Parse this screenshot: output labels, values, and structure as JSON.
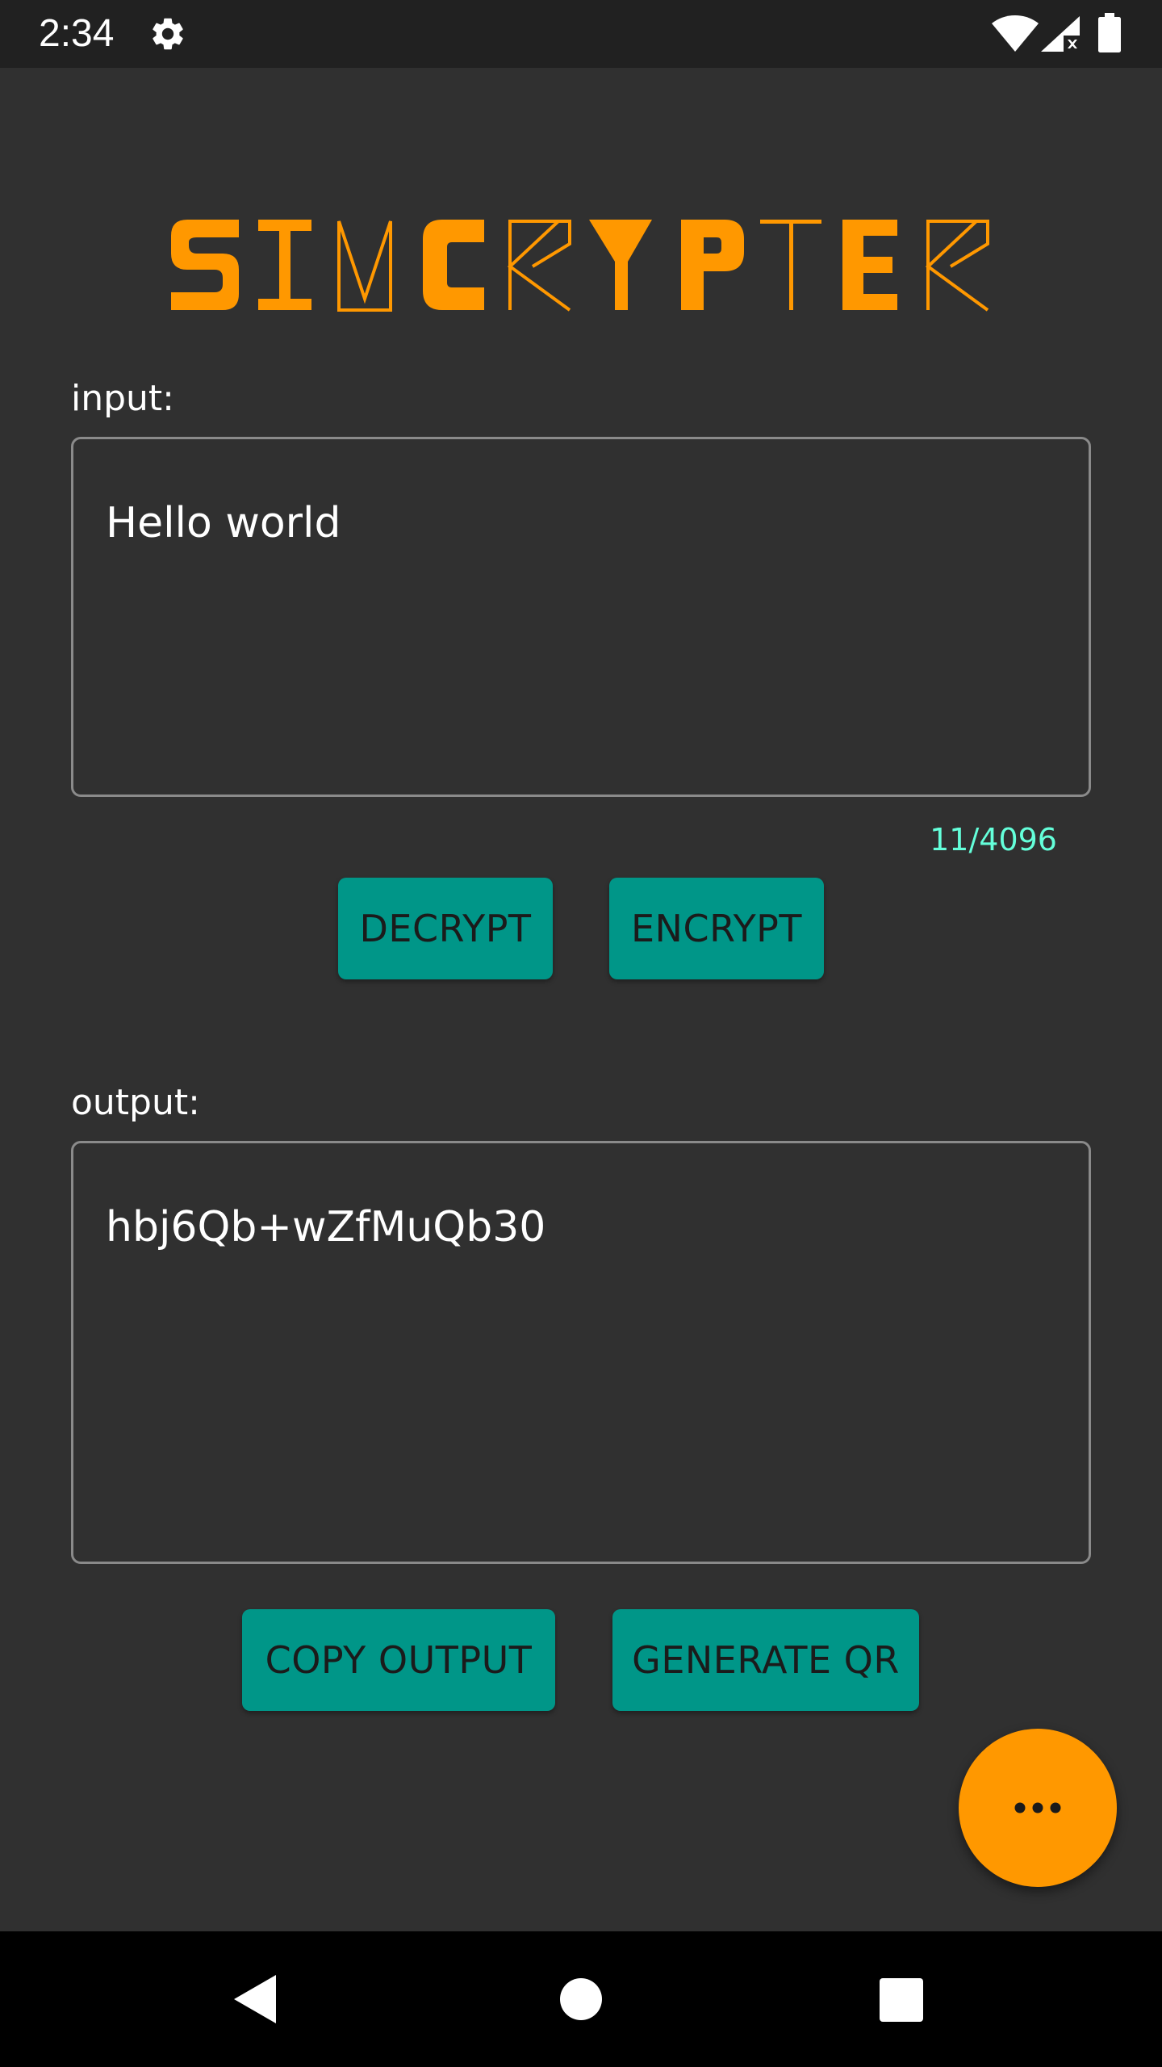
{
  "status_bar": {
    "time": "2:34",
    "icons": [
      "gear-icon",
      "wifi-icon",
      "signal-no-data-icon",
      "battery-icon"
    ]
  },
  "app": {
    "logo_text": "SIMCRYPTER",
    "accent_color": "#ff9800",
    "button_color": "#009688",
    "background_color": "#303030"
  },
  "input": {
    "label": "input:",
    "value": "Hello world",
    "counter": "11/4096"
  },
  "actions": {
    "decrypt_label": "DECRYPT",
    "encrypt_label": "ENCRYPT"
  },
  "output": {
    "label": "output:",
    "value": "hbj6Qb+wZfMuQb30"
  },
  "output_actions": {
    "copy_label": "COPY OUTPUT",
    "qr_label": "GENERATE QR"
  },
  "fab": {
    "icon": "more-horizontal-icon"
  },
  "nav_bar": {
    "icons": [
      "back-icon",
      "home-icon",
      "recents-icon"
    ]
  }
}
